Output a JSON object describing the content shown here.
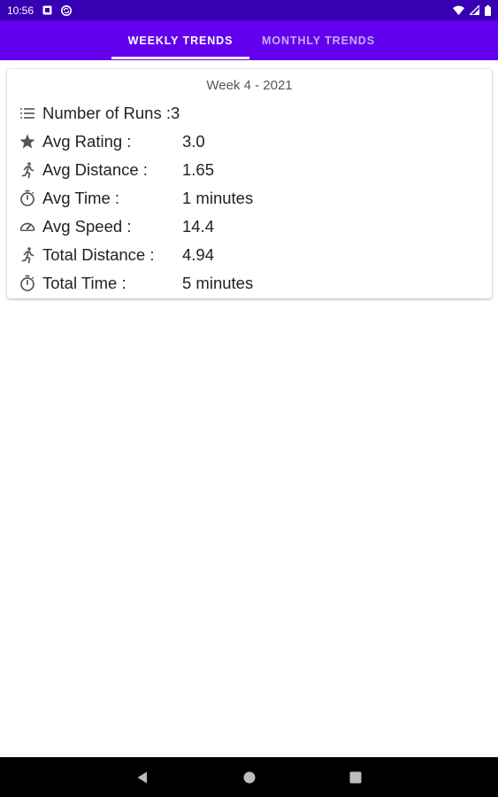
{
  "status_bar": {
    "time": "10:56",
    "icons": [
      "notification-square-icon",
      "sync-circle-icon",
      "wifi-icon",
      "signal-icon",
      "battery-icon"
    ]
  },
  "tabs": [
    {
      "label": "WEEKLY TRENDS",
      "selected": true
    },
    {
      "label": "MONTHLY TRENDS",
      "selected": false
    }
  ],
  "card": {
    "title": "Week 4 - 2021",
    "rows": [
      {
        "icon": "list-icon",
        "label": "Number of Runs :",
        "value": "3"
      },
      {
        "icon": "star-icon",
        "label": "Avg Rating :",
        "value": "3.0"
      },
      {
        "icon": "runner-icon",
        "label": "Avg Distance :",
        "value": "1.65"
      },
      {
        "icon": "timer-icon",
        "label": "Avg Time :",
        "value": "1 minutes"
      },
      {
        "icon": "speedometer-icon",
        "label": "Avg Speed :",
        "value": "14.4"
      },
      {
        "icon": "runner-icon",
        "label": "Total Distance :",
        "value": "4.94"
      },
      {
        "icon": "timer-icon",
        "label": "Total Time :",
        "value": "5 minutes"
      }
    ]
  },
  "nav_bar": {
    "buttons": [
      "back-icon",
      "home-icon",
      "recents-icon"
    ]
  },
  "colors": {
    "status_bar": "#3700b3",
    "tab_bar": "#6200ee",
    "tab_selected": "#ffffff",
    "tab_unselected": "#c7aef7"
  }
}
